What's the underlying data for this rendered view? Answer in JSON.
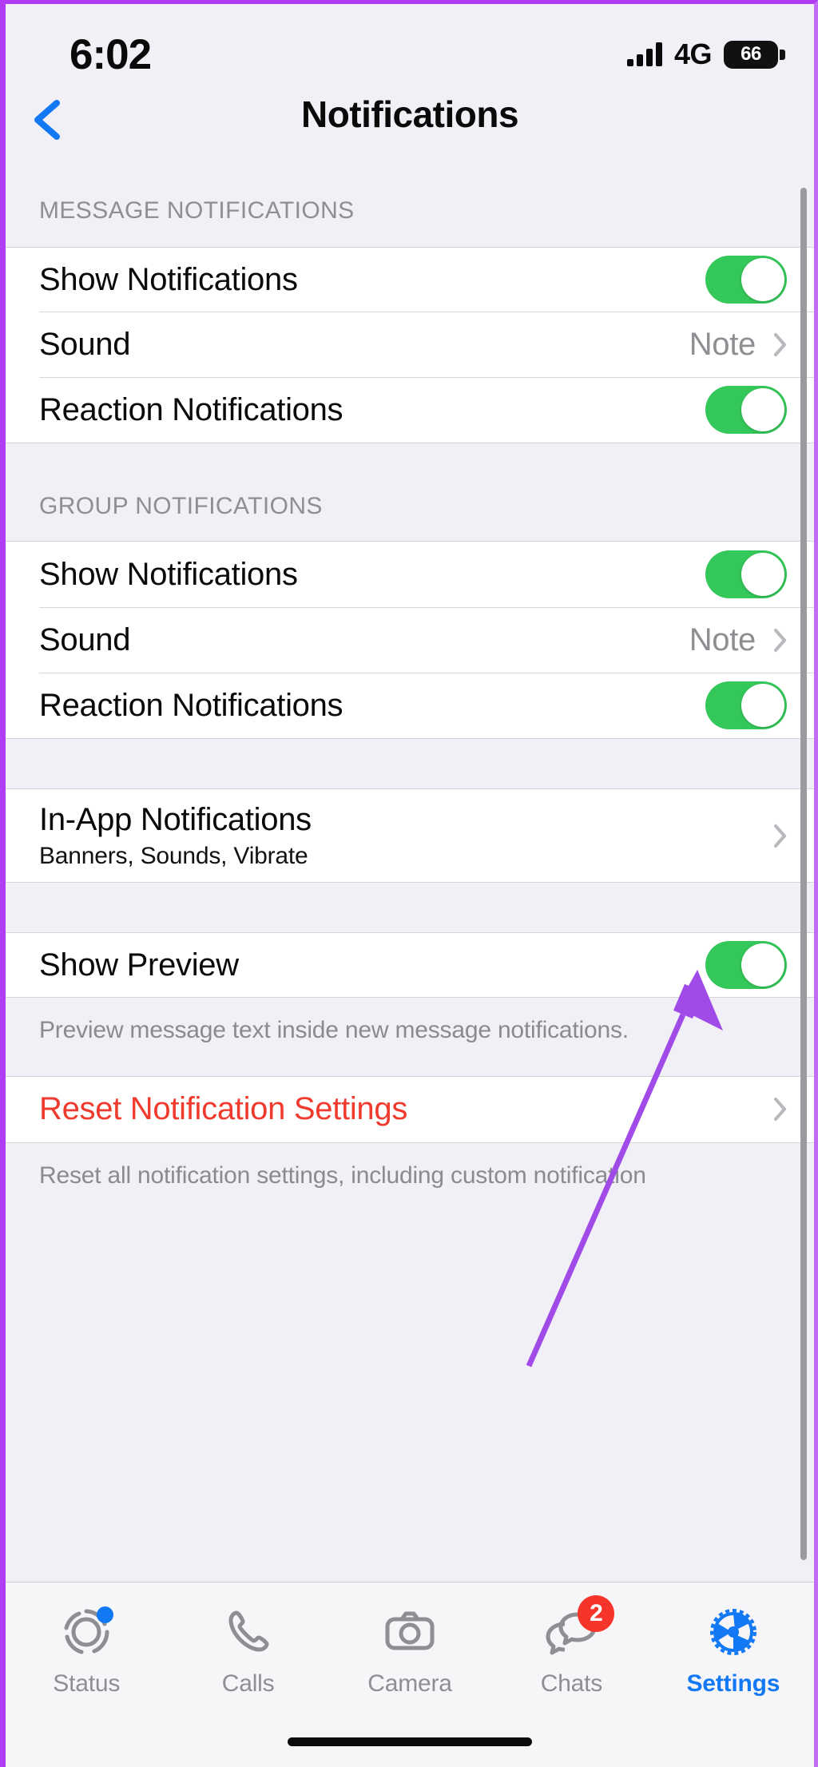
{
  "status_bar": {
    "time": "6:02",
    "network_type": "4G",
    "battery_level": "66",
    "signal_icon": "signal-bars-icon"
  },
  "nav": {
    "title": "Notifications",
    "back_icon": "chevron-left-icon"
  },
  "sections": [
    {
      "header": "MESSAGE NOTIFICATIONS",
      "rows": [
        {
          "label": "Show Notifications",
          "type": "toggle",
          "value": "on"
        },
        {
          "label": "Sound",
          "type": "disclosure",
          "value": "Note"
        },
        {
          "label": "Reaction Notifications",
          "type": "toggle",
          "value": "on"
        }
      ]
    },
    {
      "header": "GROUP NOTIFICATIONS",
      "rows": [
        {
          "label": "Show Notifications",
          "type": "toggle",
          "value": "on"
        },
        {
          "label": "Sound",
          "type": "disclosure",
          "value": "Note"
        },
        {
          "label": "Reaction Notifications",
          "type": "toggle",
          "value": "on"
        }
      ]
    },
    {
      "header": "",
      "rows": [
        {
          "label": "In-App Notifications",
          "sublabel": "Banners, Sounds, Vibrate",
          "type": "disclosure",
          "value": ""
        }
      ]
    },
    {
      "header": "",
      "rows": [
        {
          "label": "Show Preview",
          "type": "toggle",
          "value": "on"
        }
      ],
      "footnote": "Preview message text inside new message notifications."
    },
    {
      "header": "",
      "rows": [
        {
          "label": "Reset Notification Settings",
          "type": "disclosure",
          "value": "",
          "destructive": true
        }
      ],
      "footnote": "Reset all notification settings, including custom notification"
    }
  ],
  "tab_bar": {
    "tabs": [
      {
        "label": "Status",
        "icon": "status-ring-icon",
        "badge_dot": true,
        "active": false
      },
      {
        "label": "Calls",
        "icon": "phone-icon",
        "active": false
      },
      {
        "label": "Camera",
        "icon": "camera-icon",
        "active": false
      },
      {
        "label": "Chats",
        "icon": "chat-bubbles-icon",
        "badge_count": "2",
        "active": false
      },
      {
        "label": "Settings",
        "icon": "gear-icon",
        "active": true
      }
    ]
  },
  "colors": {
    "accent_blue": "#1278f3",
    "toggle_green": "#34c759",
    "destructive_red": "#f03a2e",
    "badge_red": "#f5352a",
    "annotation_purple": "#a04ae8",
    "group_bg": "#f1f0f6"
  },
  "annotation": {
    "type": "arrow",
    "points_to": "Reaction Notifications toggle in GROUP NOTIFICATIONS"
  }
}
